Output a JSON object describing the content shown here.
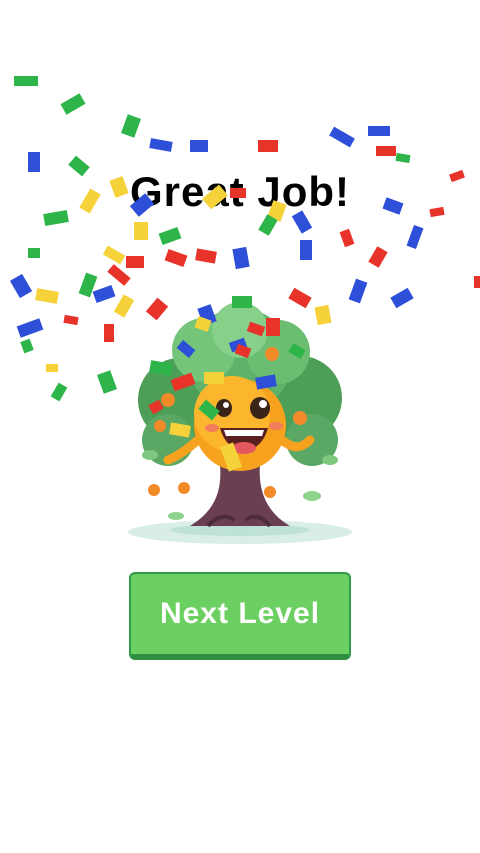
{
  "screen": {
    "title": "Great Job!",
    "next_button_label": "Next Level"
  },
  "mascot": {
    "icon": "smiling-orange-tree-mascot-icon"
  },
  "confetti": {
    "icon": "confetti-icon",
    "colors": [
      "#2e4fd8",
      "#e8332b",
      "#2db54a",
      "#f5d23a"
    ]
  },
  "colors": {
    "button_fill": "#6ccf62",
    "button_border": "#2f8f44",
    "title_text": "#000000"
  }
}
